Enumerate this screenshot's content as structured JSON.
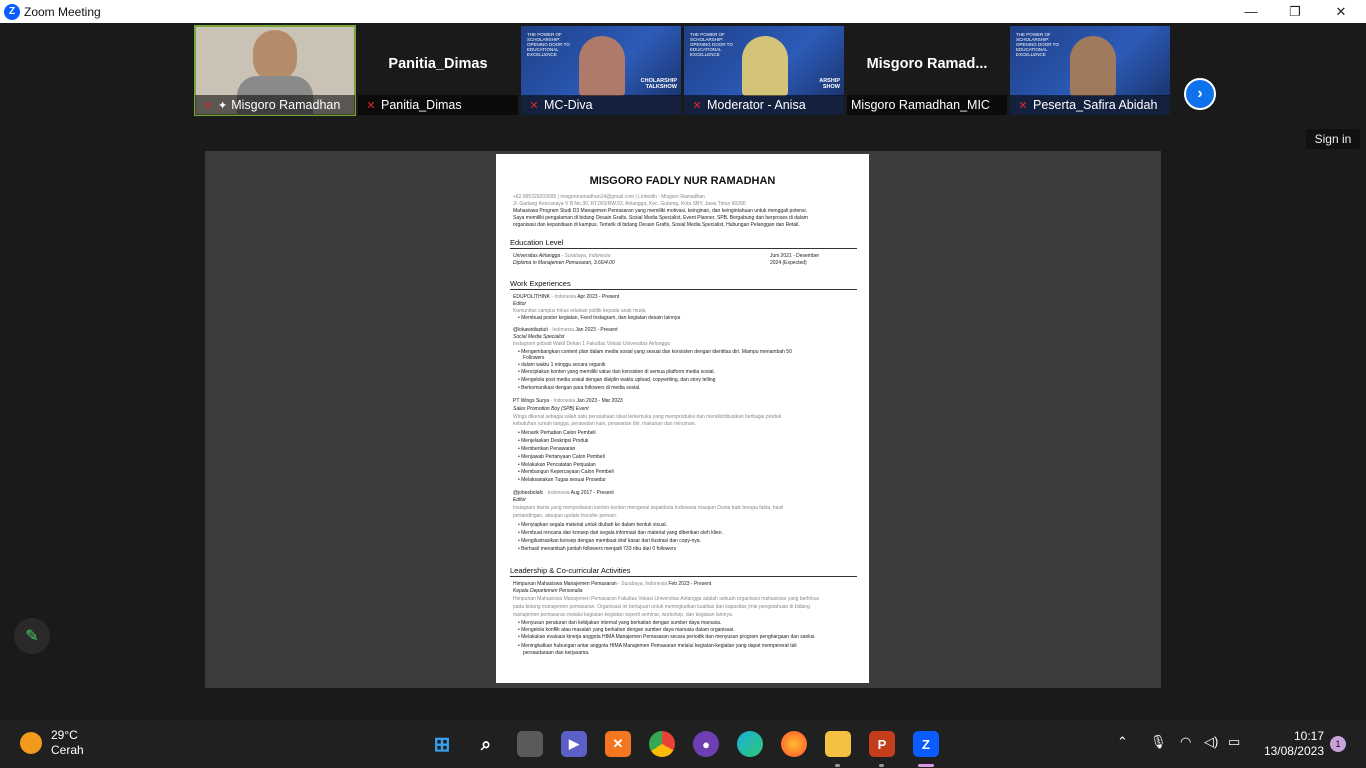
{
  "window": {
    "title": "Zoom Meeting",
    "logo": "Z"
  },
  "controls": {
    "minimize": "—",
    "restore": "❐",
    "close": "✕"
  },
  "participants": [
    {
      "name": "Misgoro Ramadhan",
      "muted": true,
      "display": "video"
    },
    {
      "name": "Panitia_Dimas",
      "muted": true,
      "display": "name",
      "big_label": "Panitia_Dimas"
    },
    {
      "name": "MC-Diva",
      "muted": true,
      "display": "video",
      "side_text": "CHOLARSHIP\nTALKSHOW"
    },
    {
      "name": "Moderator - Anisa",
      "muted": true,
      "display": "video",
      "side_text": "ARSHIP\nSHOW"
    },
    {
      "name": "Misgoro Ramadhan_MIC",
      "muted": false,
      "display": "name",
      "big_label": "Misgoro  Ramad..."
    },
    {
      "name": "Peserta_Safira Abidah",
      "muted": true,
      "display": "video"
    }
  ],
  "banner_text": "THE POWER OF SCHOLARSHIP: OPENING DOOR TO EDUCATIONAL EXCELLENCE",
  "next_button": "›",
  "sign_in": "Sign in",
  "document": {
    "name": "MISGORO FADLY NUR RAMADHAN",
    "contact": "+62 895329203095 | misgororamadhan14@gmail.com | LinkedIn : Misgoro Ramadhan",
    "address": "Jl. Gadang Kencanaya V B No.30, RT.003/RW.03, Airlangga, Kec. Gubeng, Kota SBY, Jawa Timur 60286",
    "summary": [
      "Mahasiswa Program Studi D3 Manajemen Pemasaran yang memiliki motivasi, keinginan, dan keingintahuan untuk menggali potensi.",
      "Saya memiliki pengalaman di bidang Desain Grafis, Sosial Media Specialist, Event Planner, SPB. Bergabung dan berproses di dalam",
      "organisasi dan kepanitiaan di kampus. Tertarik di bidang Desain Grafis, Sosial Media Specialist, Hubungan Pelanggan dan Retail."
    ],
    "sections": {
      "education": "Education Level",
      "work": "Work Experiences",
      "leadership": "Leadership & Co-curricular Activities"
    },
    "education": {
      "school": "Universitas Airlangga",
      "loc": " - Surabaya, Indonesia",
      "degree": "Diploma in Manajemen Pemasaran, 3.66/4.00",
      "date1": "Juni  2021  -  Desember",
      "date2": "2024 (Expected)"
    },
    "jobs": [
      {
        "org": "EDUPOLITHINK",
        "loc": " - Indonesia",
        "date": " Apr 2023 - Present",
        "role": "Editor",
        "desc": [
          "Komunitas campus fokus edukasi politik kepada anak muda"
        ],
        "bullets": [
          "Membuat poster kegiatan, Feed Instagram, dan kegiatan desain lainnya"
        ]
      },
      {
        "org": "@lokawidiastuti",
        "loc": " - Indonesia",
        "date": " Jan 2023 - Present",
        "role": "Social Media Specialist",
        "desc": [
          "Instagram pribadi Wakil Dekan 1 Fakultas Vokasi Universitas Airlangga"
        ],
        "bullets": [
          "Mengembangkan content plan dalam media sosial yang sesuai dan konsisten dengan identitas diri. Mampu menambah 50",
          "Followers",
          "dalam waktu 1 minggu secara organik",
          "Menciptakan konten yang memiliki value dan konsisten di semua platform media sosial.",
          "Mengelola post media sosial dengan disiplin waktu upload, copywriting, dan story telling",
          "Berkomunikasi dengan para followers di media sosial."
        ]
      },
      {
        "org": "PT Wings Surya",
        "loc": " - Indonesia",
        "date": " Jan 2023 - Mar 2023",
        "role": "Sales Promotion Boy (SPB) Event",
        "desc": [
          "Wings dikenal sebagai salah satu perusahaan lokal terkemuka yang memproduksi dan mendistribusikan berbagai produk",
          "kebutuhan rumah tangga, perawatan kain, perawatan diri, makanan dan minuman."
        ],
        "bullets": [
          "Menarik Perhatian Calon Pembeli",
          "Menjelaskan Deskripsi Produk",
          "Memberikan Penawaran",
          "Menjawab Pertanyaan Calon Pembeli",
          "Melakukan Pencatatan Penjualan",
          "Membangun Kepercayaan Calon Pembeli",
          "Melaksanakan Tugas sesuai Prosedur"
        ]
      },
      {
        "org": "@jobesbolafc",
        "loc": " - Indonesia",
        "date": " Aug 2017 - Present",
        "role": "Editor",
        "desc": [
          "Instagram bisnis yang menyediakan konten-konten mengenai sepakbola Indonesia maupun Dunia baik berupa fakta, hasil",
          "pertandingan, ataupun update transfer pemain."
        ],
        "bullets": [
          "Menyiapkan segala material untuk diubah ke dalam bentuk visual.",
          "Membuat rencana dan konsep dari segala informasi dan material yang diberikan oleh klien.",
          "Mengilustrasikan konsep dengan membuat draf kasar dari ilustrasi dan copy-nya.",
          "Berhasil menambah jumlah followers menjadi 733 ribu dari 0 followers"
        ]
      }
    ],
    "leadership": {
      "org": "Himpunan Mahasiswa Manajemen Pemasaran",
      "loc": " - Surabaya, Indonesia",
      "date": " Feb 2023 - Present",
      "role": "Kepala Departemen Personalia",
      "desc": [
        "Himpunan Mahasiswa Manajemen Pemasaran Fakultas Vokasi Universitas Airlangga adalah sebuah organisasi mahasiswa yang berfokus",
        "pada bidang manajemen pemasaran. Organisasi ini bertujuan untuk meningkatkan kualitas dan kapasitas (mie pengetahuan di bidang",
        "manajemen pemasaran melalui kegiatan-kegiatan seperti seminar, workshop, dan kegiatan lainnya."
      ],
      "bullets": [
        "Menyusun peraturan dan kebijakan internal yang berkaitan dengan sumber daya manusia.",
        "Mengelola konflik atau masalah yang berkaitan dengan sumber daya manusia dalam organisasi.",
        "Melakukan evaluasi kinerja anggota HIMA Manajemen Pemasaran secara periodik dan menyusun program penghargaan dan sanksi.",
        "Meningkatkan hubungan antar anggota HIMA Manajemen Pemasaran melalui kegiatan-kegiatan yang dapat mempererat tali",
        "persaudaraan dan kerjasama."
      ]
    }
  },
  "taskbar": {
    "temp": "29°C",
    "weather": "Cerah",
    "time": "10:17",
    "date": "13/08/2023",
    "notifications": "1",
    "apps": [
      "windows-start",
      "search",
      "task-view",
      "meet",
      "xampp",
      "chrome",
      "github",
      "edge",
      "firefox",
      "file-explorer",
      "powerpoint",
      "zoom"
    ]
  },
  "colors": {
    "zoom_blue": "#0b5cff",
    "active_outline": "#7aa33a",
    "muted_red": "#e02828"
  }
}
